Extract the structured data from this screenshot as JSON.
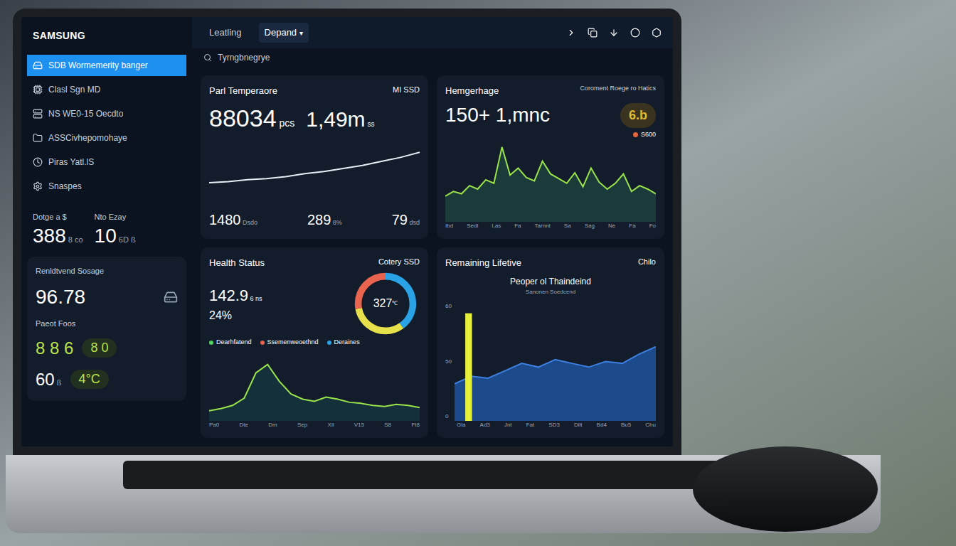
{
  "brand": "SAMSUNG",
  "topbar": {
    "tabs": [
      {
        "label": "Leatling",
        "selected": false
      },
      {
        "label": "Depand",
        "selected": true
      }
    ],
    "dropdown": "▾",
    "search": {
      "placeholder": "Tyrngbnegrye"
    }
  },
  "sidebar": {
    "items": [
      {
        "label": "SDB Wormemerity banger",
        "selected": true
      },
      {
        "label": "Clasl Sgn MD",
        "selected": false
      },
      {
        "label": "NS WE0-15 Oecdto",
        "selected": false
      },
      {
        "label": "ASSCivhepomohaye",
        "selected": false
      },
      {
        "label": "Piras Yatl.lS",
        "selected": false
      },
      {
        "label": "Snaspes",
        "selected": false
      }
    ],
    "stats": [
      {
        "label": "Dotge a $",
        "value": "388",
        "unit": "8 co"
      },
      {
        "label": "Nto Ezay",
        "value": "10",
        "unit": "6D ß"
      }
    ],
    "storage": {
      "title": "Renldtvend Sosage",
      "value": "96.78",
      "sub": "Paeot Foos",
      "reading": "8 8 6",
      "badge": "8 0",
      "temp": "60",
      "temp_unit": "ß",
      "temp_badge": "4°C"
    }
  },
  "cards": {
    "temperature": {
      "title": "Parl Temperaore",
      "tag": "MI SSD",
      "value": "88034",
      "unit": "pcs",
      "value2": "1,49m",
      "unit2": "ss",
      "series": [
        20,
        21,
        23,
        24,
        26,
        29,
        31,
        34,
        37,
        41,
        45,
        50
      ],
      "max": 60,
      "readings": [
        {
          "value": "1480",
          "unit": "Dsdo"
        },
        {
          "value": "289",
          "unit": "8%"
        },
        {
          "value": "79",
          "unit": "dsd"
        }
      ]
    },
    "hemgerhage": {
      "title": "Hemgerhage",
      "value": "150+ 1,mnc",
      "note": "Coroment Roege ro Hatics",
      "badge": "6.b",
      "legend": "S600",
      "legend_color": "#e8643c",
      "series": [
        22,
        26,
        24,
        31,
        28,
        36,
        33,
        64,
        40,
        46,
        38,
        35,
        52,
        41,
        37,
        33,
        42,
        30,
        46,
        34,
        28,
        33,
        41,
        26,
        31,
        28,
        24
      ],
      "max": 70,
      "x_labels": [
        "Ibd",
        "Sedl",
        "I,as",
        "Fa",
        "Tarnnt",
        "Sa",
        "Sag",
        "Ne",
        "Fa",
        "Fo"
      ]
    },
    "health": {
      "title": "Health Status",
      "tag": "Cotery SSD",
      "value": "142.9",
      "unit": "6 ns",
      "percent": "24%",
      "donut": {
        "label": "327",
        "unit": "℃",
        "segments": [
          {
            "value": 40,
            "color": "#29a3e6"
          },
          {
            "value": 32,
            "color": "#e6e04a"
          },
          {
            "value": 28,
            "color": "#e8644f"
          }
        ]
      },
      "legend": [
        {
          "label": "Dearhfatend",
          "color": "#4ed35a"
        },
        {
          "label": "Ssemenweoethnd",
          "color": "#e8644f"
        },
        {
          "label": "Deraines",
          "color": "#29a3e6"
        }
      ],
      "series": [
        10,
        12,
        15,
        22,
        46,
        54,
        38,
        26,
        21,
        19,
        23,
        21,
        18,
        17,
        15,
        14,
        16,
        15,
        13
      ],
      "max": 70,
      "x_labels": [
        "Pa0",
        "Dte",
        "Dm",
        "Sep",
        "Xil",
        "V15",
        "S8",
        "Ft8"
      ]
    },
    "lifetime": {
      "title": "Remaining Lifetive",
      "tag": "Chilo",
      "subtitle": "Peoper ol Thaindeind",
      "caption": "Sanonen Soedcend",
      "bar": 58,
      "series": [
        20,
        24,
        23,
        27,
        31,
        29,
        33,
        31,
        29,
        32,
        31,
        36,
        40
      ],
      "max": 64,
      "y_ticks": [
        "60",
        "50",
        "0"
      ],
      "x_labels": [
        "Gla",
        "Ad3",
        "Jnt",
        "Fat",
        "SD3",
        "Dllt",
        "Bd4",
        "Bu5",
        "Chu"
      ]
    }
  }
}
